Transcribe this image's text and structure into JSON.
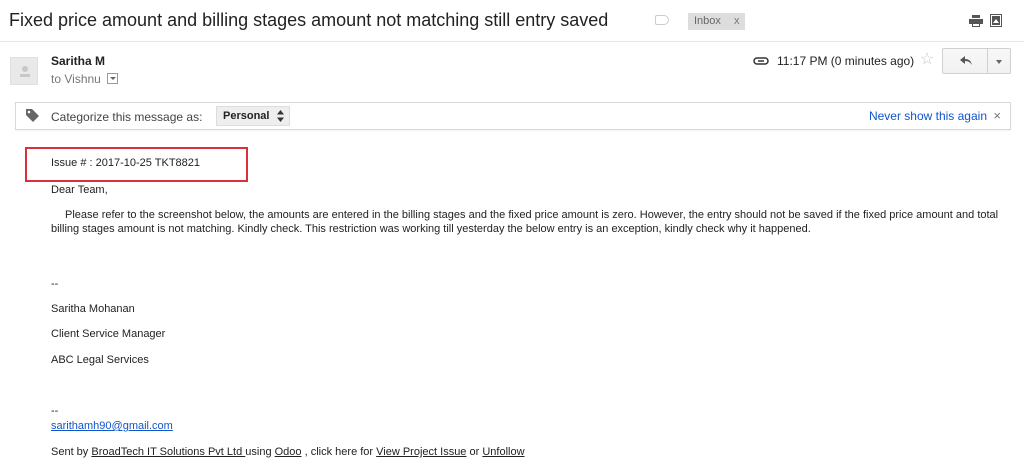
{
  "subject": "Fixed price amount and billing stages amount not matching still entry saved",
  "labels": {
    "inbox": "Inbox",
    "remove": "x"
  },
  "sender": {
    "name": "Saritha M",
    "to_prefix": "to",
    "to_name": "Vishnu"
  },
  "time": "11:17 PM (0 minutes ago)",
  "categorize": {
    "label": "Categorize this message as:",
    "selected": "Personal",
    "never_show": "Never show this again",
    "close": "×"
  },
  "body": {
    "issue": "Issue # : 2017-10-25 TKT8821",
    "greeting": "Dear Team,",
    "paragraph": "Please refer to the screenshot below, the amounts are entered in the billing stages and the fixed price amount is zero. However, the entry should not be saved if the fixed price amount and total billing stages amount is not matching. Kindly check. This restriction was working till yesterday the below entry is an exception, kindly check why it happened.",
    "sig_sep1": "--",
    "sig_name": "Saritha Mohanan",
    "sig_title": "Client Service Manager",
    "sig_company": "ABC Legal Services",
    "sig_sep2": "--",
    "email": "sarithamh90@gmail.com",
    "sent_by_prefix": "Sent by",
    "sent_by_company": "BroadTech IT Solutions Pvt Ltd ",
    "using": "using",
    "odoo": "Odoo",
    "click_here": ", click here for",
    "view_issue": "View Project Issue",
    "or": "or",
    "unfollow": "Unfollow"
  },
  "colors": {
    "link": "#1155cc",
    "highlight": "#d9303b"
  },
  "icons": [
    "label-tag-icon",
    "print-icon",
    "popout-icon",
    "avatar-icon",
    "attachment-icon",
    "star-icon",
    "reply-icon",
    "more-dropdown-icon",
    "tag-icon",
    "updown-icon"
  ]
}
